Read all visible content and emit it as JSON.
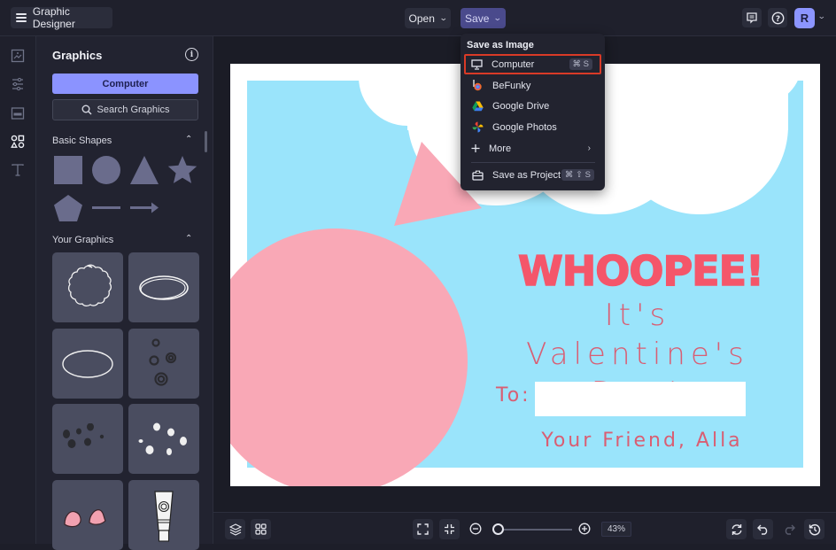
{
  "topbar": {
    "app_title": "Graphic Designer",
    "open_label": "Open",
    "save_label": "Save",
    "avatar_initial": "R",
    "icons": [
      "menu-icon",
      "comment-icon",
      "help-icon",
      "chevron-down-icon"
    ]
  },
  "rail": {
    "items": [
      {
        "name": "image-icon",
        "active": false
      },
      {
        "name": "adjustments-icon",
        "active": false
      },
      {
        "name": "layout-icon",
        "active": false
      },
      {
        "name": "graphics-icon",
        "active": true
      },
      {
        "name": "text-icon",
        "active": false
      }
    ]
  },
  "panel": {
    "title": "Graphics",
    "computer_button": "Computer",
    "search_button": "Search Graphics",
    "basic_shapes_heading": "Basic Shapes",
    "your_graphics_heading": "Your Graphics",
    "basic_shapes": [
      "square",
      "circle",
      "triangle",
      "star",
      "pentagon",
      "line",
      "arrow"
    ],
    "your_graphics": [
      "scalloped-frame",
      "scribble-oval",
      "oval-outline",
      "dark-circles",
      "dark-spots",
      "white-spots",
      "pink-cheeks",
      "paint-tube"
    ]
  },
  "dropdown": {
    "header": "Save as Image",
    "items": [
      {
        "label": "Computer",
        "icon": "monitor-icon",
        "shortcut": "⌘ S",
        "selected": true
      },
      {
        "label": "BeFunky",
        "icon": "befunky-icon"
      },
      {
        "label": "Google Drive",
        "icon": "google-drive-icon"
      },
      {
        "label": "Google Photos",
        "icon": "google-photos-icon"
      },
      {
        "label": "More",
        "icon": "plus-icon",
        "submenu": true
      }
    ],
    "project_item": {
      "label": "Save as Project",
      "icon": "briefcase-icon",
      "shortcut": "⌘ ⇧ S"
    }
  },
  "design": {
    "headline": "WHOOPEE!",
    "subline_1": "It's Valentine's",
    "subline_2": "Day!",
    "to_label": "To:",
    "signature": "Your Friend, Alla",
    "colors": {
      "sky": "#9ae4fb",
      "pink_shape": "#f9a8b6",
      "text_red": "#f4566a",
      "text_rose": "#d95e73"
    }
  },
  "bottombar": {
    "zoom_percent": "43%",
    "zoom_level": 43
  },
  "colors": {
    "accent": "#8b93ff",
    "save_button": "#4a4a8c",
    "selection_outline": "#d93a27"
  }
}
